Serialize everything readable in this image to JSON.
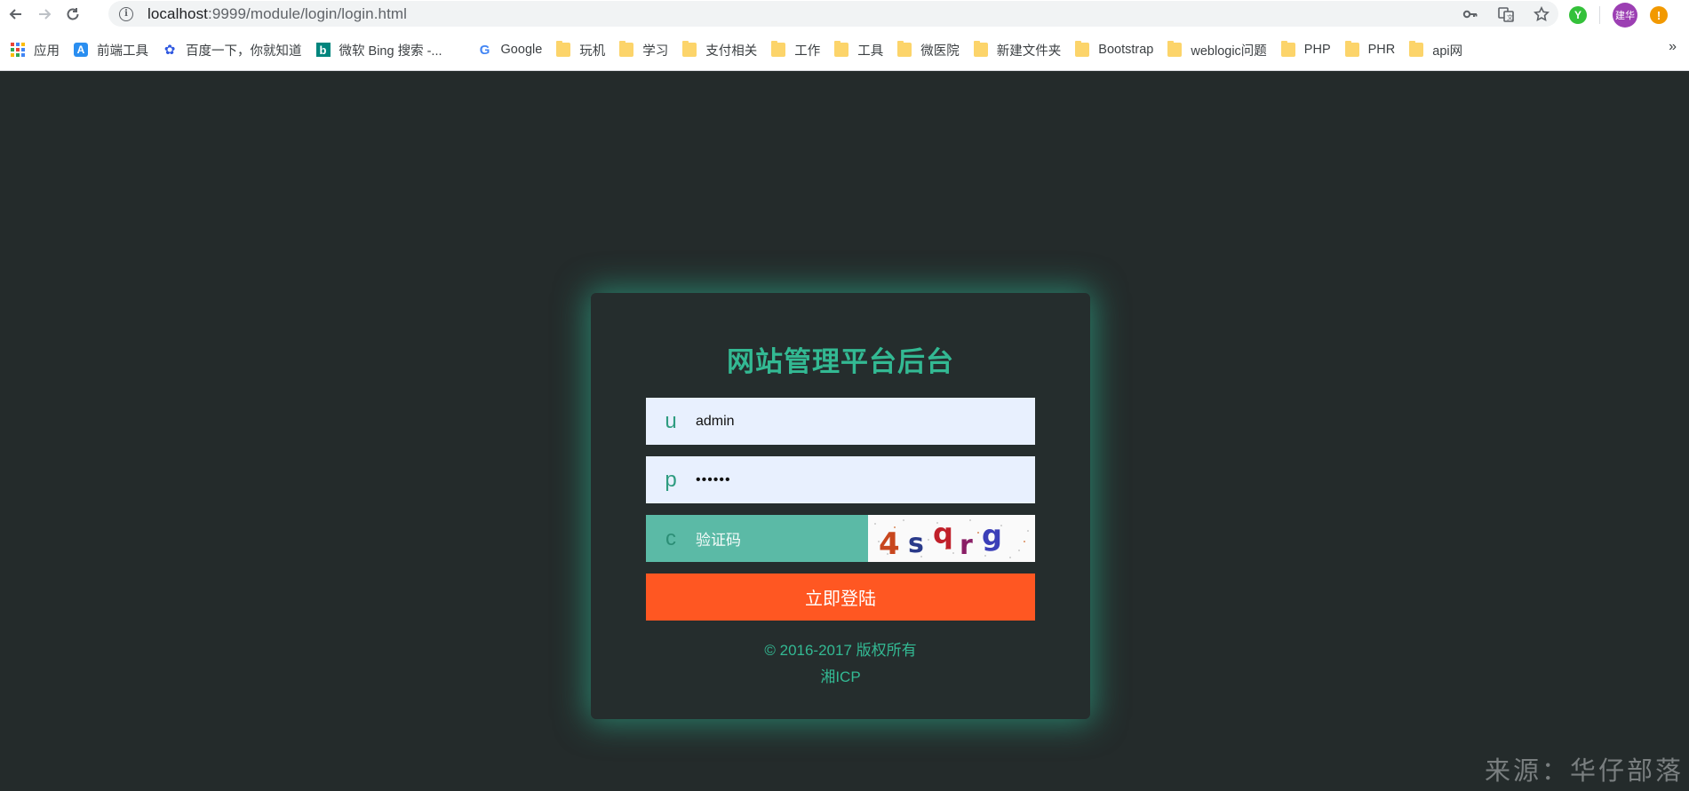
{
  "browser": {
    "url_host": "localhost",
    "url_path": ":9999/module/login/login.html",
    "avatar_text": "建华",
    "ext_green_text": "Y",
    "ext_orange_text": "!",
    "more_label": "»"
  },
  "bookmarks": [
    {
      "label": "应用",
      "icon": "apps-icon"
    },
    {
      "label": "前端工具",
      "icon": "fe-tools-icon"
    },
    {
      "label": "百度一下，你就知道",
      "icon": "baidu-icon"
    },
    {
      "label": "微软 Bing 搜索 -...",
      "icon": "bing-icon"
    },
    {
      "label": "Google",
      "icon": "google-icon"
    },
    {
      "label": "玩机",
      "icon": "folder-icon"
    },
    {
      "label": "学习",
      "icon": "folder-icon"
    },
    {
      "label": "支付相关",
      "icon": "folder-icon"
    },
    {
      "label": "工作",
      "icon": "folder-icon"
    },
    {
      "label": "工具",
      "icon": "folder-icon"
    },
    {
      "label": "微医院",
      "icon": "folder-icon"
    },
    {
      "label": "新建文件夹",
      "icon": "folder-icon"
    },
    {
      "label": "Bootstrap",
      "icon": "folder-icon"
    },
    {
      "label": "weblogic问题",
      "icon": "folder-icon"
    },
    {
      "label": "PHP",
      "icon": "folder-icon"
    },
    {
      "label": "PHR",
      "icon": "folder-icon"
    },
    {
      "label": "api网",
      "icon": "folder-icon"
    }
  ],
  "login": {
    "title": "网站管理平台后台",
    "username_prefix": "u",
    "username_value": "admin",
    "password_prefix": "p",
    "password_value": "••••••",
    "captcha_prefix": "c",
    "captcha_placeholder": "验证码",
    "captcha_text": "4sqrg",
    "submit_label": "立即登陆",
    "copyright_line1": "© 2016-2017 版权所有",
    "copyright_line2": "湘ICP"
  },
  "watermark": "来源：华仔部落",
  "colors": {
    "page_bg": "#242b2b",
    "accent_green": "#33b993",
    "submit_orange": "#ff5722",
    "captcha_field": "#5bbaa6",
    "input_bg": "#e8f0fe"
  }
}
